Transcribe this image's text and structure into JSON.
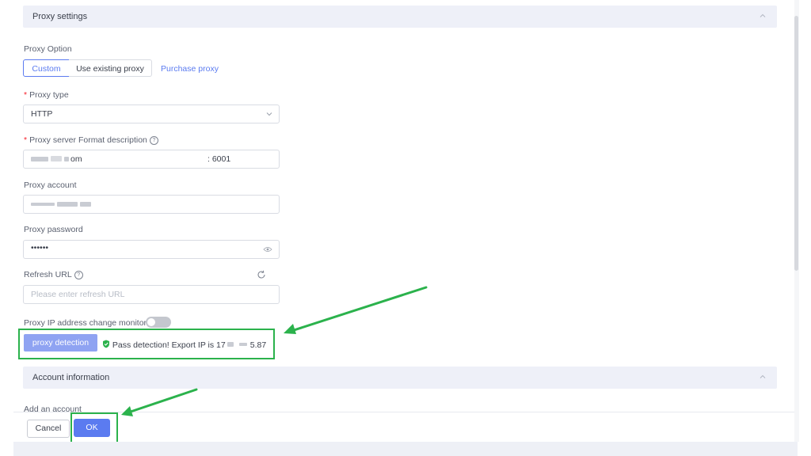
{
  "proxy_panel": {
    "title": "Proxy settings"
  },
  "proxy_option": {
    "label": "Proxy Option",
    "options": [
      "Custom",
      "Use existing proxy"
    ],
    "selected": "Custom",
    "purchase_link": "Purchase proxy"
  },
  "proxy_type": {
    "required": "*",
    "label": "Proxy type",
    "value": "HTTP"
  },
  "proxy_server": {
    "required": "*",
    "label": "Proxy server Format description",
    "host_visible": "om",
    "port": ": 6001"
  },
  "proxy_account": {
    "label": "Proxy account"
  },
  "proxy_password": {
    "label": "Proxy password",
    "value": "••••••"
  },
  "refresh_url": {
    "label": "Refresh URL",
    "placeholder": "Please enter refresh URL"
  },
  "ip_monitor": {
    "label": "Proxy IP address change monitor",
    "enabled": false
  },
  "detection": {
    "button_label": "proxy detection",
    "status_prefix": "Pass detection! Export IP is 17",
    "status_suffix": "5.87"
  },
  "account_panel": {
    "title": "Account information"
  },
  "add_account": {
    "label": "Add an account"
  },
  "footer": {
    "cancel_label": "Cancel",
    "ok_label": "OK"
  },
  "colors": {
    "primary": "#5b7bf0",
    "annotation_green": "#2bb24c",
    "success": "#2bb24c",
    "required": "#f5222d"
  }
}
